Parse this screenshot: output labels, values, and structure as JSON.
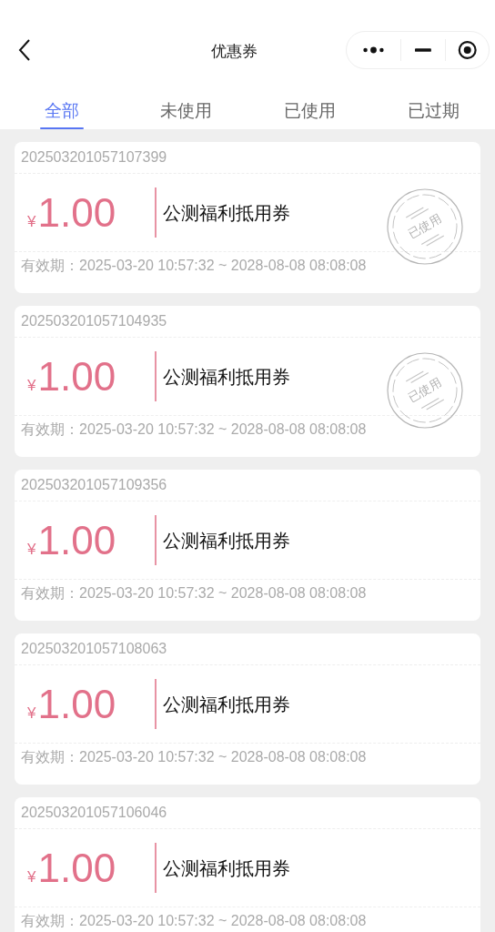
{
  "header": {
    "title": "优惠券"
  },
  "tabs": [
    {
      "label": "全部",
      "selected": true
    },
    {
      "label": "未使用",
      "selected": false
    },
    {
      "label": "已使用",
      "selected": false
    },
    {
      "label": "已过期",
      "selected": false
    }
  ],
  "coupons": [
    {
      "serial": "202503201057107399",
      "currency": "¥",
      "amount": "1.00",
      "name": "公测福利抵用券",
      "validity": "有效期：2025-03-20 10:57:32 ~ 2028-08-08 08:08:08",
      "used": true,
      "stamp": "已使用"
    },
    {
      "serial": "202503201057104935",
      "currency": "¥",
      "amount": "1.00",
      "name": "公测福利抵用券",
      "validity": "有效期：2025-03-20 10:57:32 ~ 2028-08-08 08:08:08",
      "used": true,
      "stamp": "已使用"
    },
    {
      "serial": "202503201057109356",
      "currency": "¥",
      "amount": "1.00",
      "name": "公测福利抵用券",
      "validity": "有效期：2025-03-20 10:57:32 ~ 2028-08-08 08:08:08",
      "used": false
    },
    {
      "serial": "202503201057108063",
      "currency": "¥",
      "amount": "1.00",
      "name": "公测福利抵用券",
      "validity": "有效期：2025-03-20 10:57:32 ~ 2028-08-08 08:08:08",
      "used": false
    },
    {
      "serial": "202503201057106046",
      "currency": "¥",
      "amount": "1.00",
      "name": "公测福利抵用券",
      "validity": "有效期：2025-03-20 10:57:32 ~ 2028-08-08 08:08:08",
      "used": false
    }
  ]
}
